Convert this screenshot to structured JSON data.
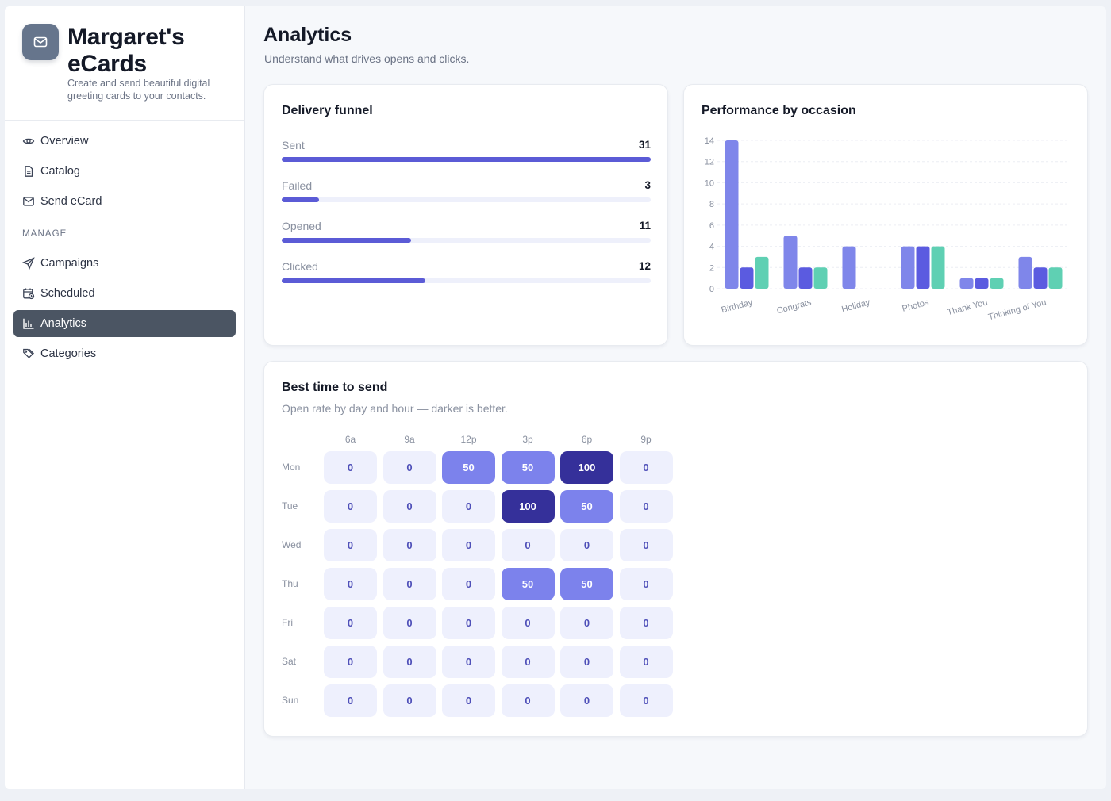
{
  "brand": {
    "name_line1": "Margaret's",
    "name_line2": "eCards",
    "description": "Create and send beautiful digital greeting cards to your contacts."
  },
  "nav": {
    "items": [
      {
        "label": "Overview",
        "icon": "eye-icon"
      },
      {
        "label": "Catalog",
        "icon": "document-icon"
      },
      {
        "label": "Send eCard",
        "icon": "mail-send-icon"
      }
    ],
    "section_label": "MANAGE",
    "manage_items": [
      {
        "label": "Campaigns",
        "icon": "paper-plane-icon"
      },
      {
        "label": "Scheduled",
        "icon": "calendar-clock-icon"
      },
      {
        "label": "Analytics",
        "icon": "bar-chart-icon",
        "active": true
      },
      {
        "label": "Categories",
        "icon": "tags-icon"
      }
    ]
  },
  "page": {
    "title": "Analytics",
    "subtitle": "Understand what drives opens and clicks."
  },
  "funnel": {
    "title": "Delivery funnel",
    "rows": [
      {
        "label": "Sent",
        "value": "31",
        "fraction": 1.0
      },
      {
        "label": "Failed",
        "value": "3",
        "fraction": 0.1
      },
      {
        "label": "Opened",
        "value": "11",
        "fraction": 0.35
      },
      {
        "label": "Clicked",
        "value": "12",
        "fraction": 0.39
      }
    ],
    "bar_color": "#5b5bd6",
    "track_color": "#eef0fb"
  },
  "occasion": {
    "title": "Performance by occasion"
  },
  "chart_data": {
    "type": "bar",
    "categories": [
      "Birthday",
      "Congrats",
      "Holiday",
      "Photos",
      "Thank You",
      "Thinking of You"
    ],
    "series": [
      {
        "values": [
          14,
          5,
          4,
          4,
          1,
          3
        ],
        "color": "#7f86ea"
      },
      {
        "values": [
          2,
          2,
          0,
          4,
          1,
          2
        ],
        "color": "#5b5be0"
      },
      {
        "values": [
          3,
          2,
          0,
          4,
          1,
          2
        ],
        "color": "#5fd0b3"
      }
    ],
    "ylim": [
      0,
      14
    ],
    "yticks": [
      "0",
      "2",
      "4",
      "6",
      "8",
      "10",
      "12",
      "14"
    ],
    "grid": true,
    "xlabel": "",
    "ylabel": ""
  },
  "heatmap": {
    "title": "Best time to send",
    "subtitle": "Open rate by day and hour — darker is better.",
    "columns": [
      "6a",
      "9a",
      "12p",
      "3p",
      "6p",
      "9p"
    ],
    "rows": [
      {
        "day": "Mon",
        "values": [
          "0",
          "0",
          "50",
          "50",
          "100",
          "0"
        ]
      },
      {
        "day": "Tue",
        "values": [
          "0",
          "0",
          "0",
          "100",
          "50",
          "0"
        ]
      },
      {
        "day": "Wed",
        "values": [
          "0",
          "0",
          "0",
          "0",
          "0",
          "0"
        ]
      },
      {
        "day": "Thu",
        "values": [
          "0",
          "0",
          "0",
          "50",
          "50",
          "0"
        ]
      },
      {
        "day": "Fri",
        "values": [
          "0",
          "0",
          "0",
          "0",
          "0",
          "0"
        ]
      },
      {
        "day": "Sat",
        "values": [
          "0",
          "0",
          "0",
          "0",
          "0",
          "0"
        ]
      },
      {
        "day": "Sun",
        "values": [
          "0",
          "0",
          "0",
          "0",
          "0",
          "0"
        ]
      }
    ],
    "colors": {
      "zero": "#eef0fd",
      "mid": "#7c82ec",
      "high": "#35309a",
      "zero_text": "#4e4fb8",
      "text": "#ffffff"
    }
  }
}
